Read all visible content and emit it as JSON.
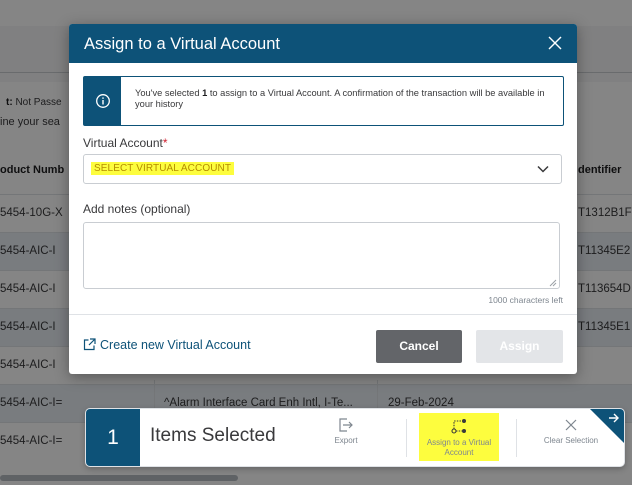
{
  "background": {
    "filter_prefix": "t:",
    "filter_value": "Not Passe",
    "refine_text": "ine your sea",
    "columns": {
      "product_number": "oduct Numb",
      "identifier": "dentifier"
    },
    "rows": [
      {
        "product": "5454-10G-X",
        "identifier": "T1312B1F"
      },
      {
        "product": "5454-AIC-I",
        "identifier": "T11345E2"
      },
      {
        "product": "5454-AIC-I",
        "identifier": "T113654D"
      },
      {
        "product": "5454-AIC-I",
        "identifier": "T11345E1"
      },
      {
        "product": "5454-AIC-I",
        "identifier": ""
      },
      {
        "product": "5454-AIC-I=",
        "description": "^Alarm Interface Card Enh Intl, I-Te...",
        "date": "29-Feb-2024",
        "identifier": ""
      },
      {
        "product": "5454-AIC-I=",
        "identifier": ""
      }
    ]
  },
  "modal": {
    "title": "Assign to a Virtual Account",
    "close_icon": "close-icon",
    "info": {
      "icon": "info-icon",
      "text_before": "You've selected ",
      "count": "1",
      "text_after": " to assign to a Virtual Account. A confirmation of the transaction will be available in your history"
    },
    "virtual_account": {
      "label": "Virtual Account",
      "required_marker": "*",
      "value": "SELECT VIRTUAL ACCOUNT"
    },
    "notes": {
      "label": "Add notes (optional)",
      "value": "",
      "char_count": "1000 characters left"
    },
    "create_link": "Create new Virtual Account",
    "buttons": {
      "cancel": "Cancel",
      "assign": "Assign"
    }
  },
  "action_bar": {
    "count": "1",
    "label": "Items Selected",
    "export": "Export",
    "assign": "Assign to a Virtual Account",
    "clear": "Clear Selection"
  },
  "colors": {
    "brand": "#0d5278",
    "highlight": "#fdfd3e",
    "required": "#cf2030",
    "cancel_button": "#636569",
    "assign_disabled": "#e3e5e8"
  }
}
